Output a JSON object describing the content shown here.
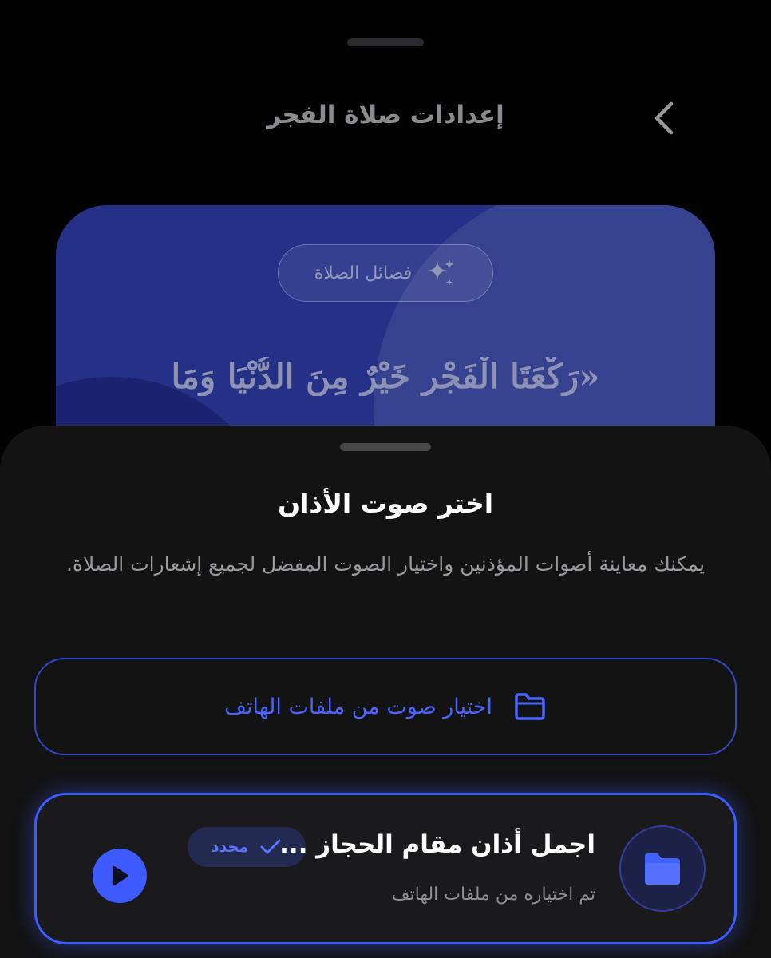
{
  "header": {
    "title": "إعدادات صلاة الفجر",
    "back_icon": "chevron-right-icon"
  },
  "card": {
    "chip_label": "فضائل الصلاة",
    "chip_icon": "sparkles-icon",
    "hadith_text": "«رَكْعَتَا الْفَجْرِ خَيْرٌ مِنَ الدُّنْيَا وَمَا"
  },
  "sheet": {
    "title": "اختر صوت الأذان",
    "description": "يمكنك معاينة أصوات المؤذنين واختيار الصوت المفضل لجميع إشعارات الصلاة.",
    "pick_button": {
      "label": "اختيار صوت من ملفات الهاتف",
      "icon": "folder-icon"
    },
    "selected_sound": {
      "title": "اجمل أذان مقام الحجاز ...",
      "subtitle": "تم اختياره من ملفات الهاتف",
      "badge_label": "محدد",
      "badge_icon": "check-icon",
      "avatar_icon": "folder-icon",
      "play_icon": "play-icon"
    }
  },
  "colors": {
    "accent": "#3d5bff",
    "sheet_bg": "#131314",
    "card_bg": "#243187"
  }
}
